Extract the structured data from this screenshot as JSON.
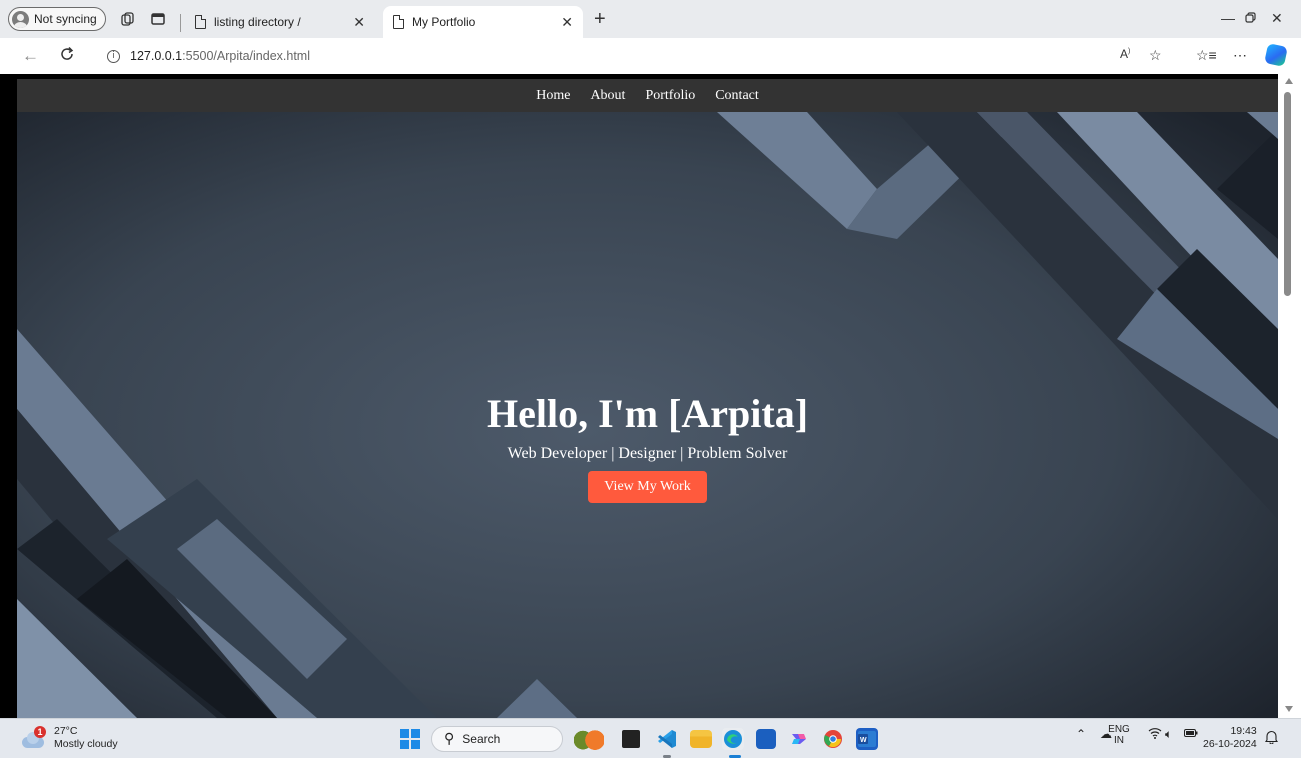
{
  "browser": {
    "profile_label": "Not syncing",
    "tabs": [
      {
        "title": "listing directory /",
        "active": false
      },
      {
        "title": "My Portfolio",
        "active": true
      }
    ],
    "address": {
      "host": "127.0.0.1",
      "path": ":5500/Arpita/index.html"
    }
  },
  "page": {
    "nav": [
      "Home",
      "About",
      "Portfolio",
      "Contact"
    ],
    "hero": {
      "title": "Hello, I'm [Arpita]",
      "subtitle": "Web Developer | Designer | Problem Solver",
      "cta": "View My Work"
    },
    "colors": {
      "nav_bg": "#333333",
      "cta_bg": "#ff5a3d",
      "hero_base": "#3a4553"
    }
  },
  "taskbar": {
    "weather": {
      "badge": "1",
      "temp": "27°C",
      "condition": "Mostly cloudy"
    },
    "search_label": "Search",
    "tray": {
      "lang_top": "ENG",
      "lang_bottom": "IN"
    },
    "clock": {
      "time": "19:43",
      "date": "26-10-2024"
    }
  }
}
